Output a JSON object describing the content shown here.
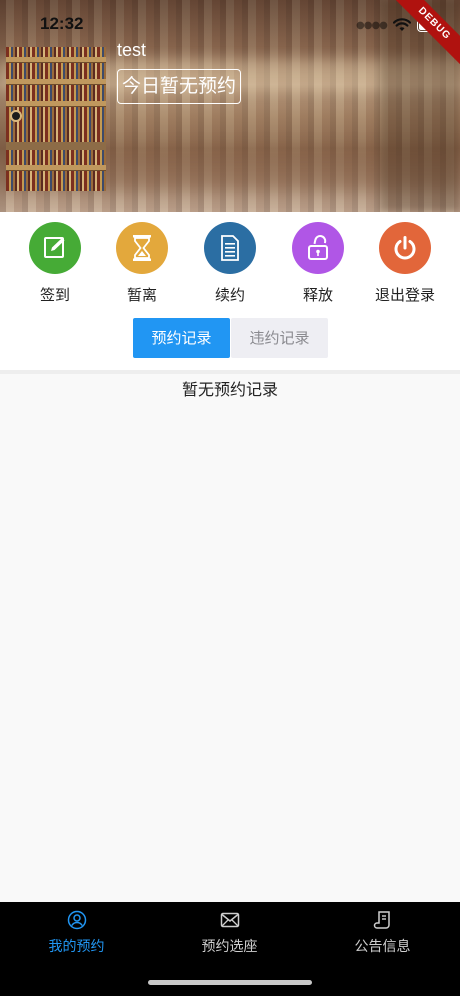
{
  "status_bar": {
    "time": "12:32"
  },
  "debug_ribbon": "DEBUG",
  "profile": {
    "username": "test",
    "today_status": "今日暂无预约"
  },
  "actions": [
    {
      "label": "签到",
      "icon": "edit-icon",
      "color": "#46ab36"
    },
    {
      "label": "暂离",
      "icon": "hourglass-icon",
      "color": "#e3a83c"
    },
    {
      "label": "续约",
      "icon": "document-icon",
      "color": "#2b6ea3"
    },
    {
      "label": "释放",
      "icon": "unlock-icon",
      "color": "#b056e6"
    },
    {
      "label": "退出登录",
      "icon": "power-icon",
      "color": "#e2663a"
    }
  ],
  "tabs": [
    {
      "label": "预约记录",
      "active": true
    },
    {
      "label": "违约记录",
      "active": false
    }
  ],
  "empty_message": "暂无预约记录",
  "bottom_nav": [
    {
      "label": "我的预约",
      "icon": "user-circle-icon",
      "active": true,
      "color": "#2196f3"
    },
    {
      "label": "预约选座",
      "icon": "mail-icon",
      "active": false,
      "color": "#cfcfcf"
    },
    {
      "label": "公告信息",
      "icon": "notice-icon",
      "active": false,
      "color": "#cfcfcf"
    }
  ]
}
